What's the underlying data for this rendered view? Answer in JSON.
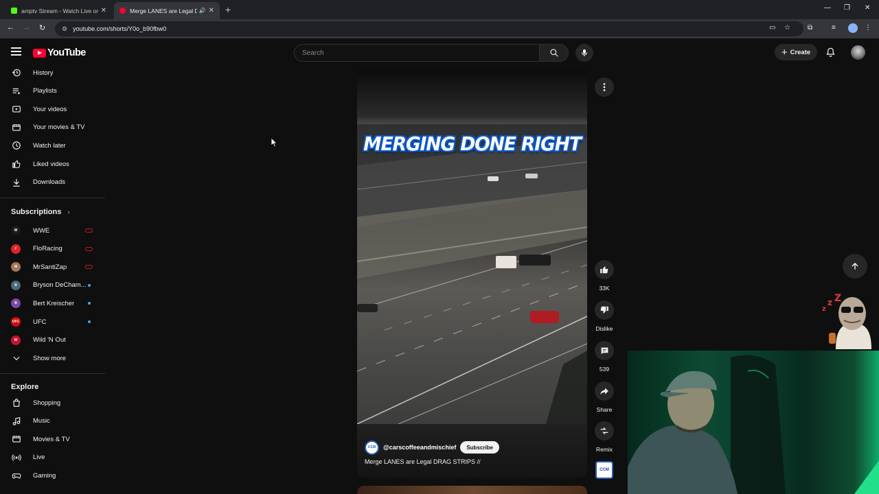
{
  "browser": {
    "tabs": [
      {
        "title": "amptv Stream - Watch Live on K",
        "favicon_color": "#53fc18",
        "active": false
      },
      {
        "title": "Merge LANES are Legal DR",
        "favicon_color": "#ff0033",
        "active": true
      }
    ],
    "url": "youtube.com/shorts/Y0o_b90fbw0"
  },
  "masthead": {
    "logo_text": "YouTube",
    "search_placeholder": "Search",
    "create_label": "Create"
  },
  "sidebar": {
    "you_items": [
      {
        "label": "History",
        "icon": "history-icon"
      },
      {
        "label": "Playlists",
        "icon": "playlists-icon"
      },
      {
        "label": "Your videos",
        "icon": "your-videos-icon"
      },
      {
        "label": "Your movies & TV",
        "icon": "movies-icon"
      },
      {
        "label": "Watch later",
        "icon": "watch-later-icon"
      },
      {
        "label": "Liked videos",
        "icon": "like-icon"
      },
      {
        "label": "Downloads",
        "icon": "download-icon"
      }
    ],
    "subscriptions_title": "Subscriptions",
    "subscriptions": [
      {
        "label": "WWE",
        "avatar_color": "#1a1a1a",
        "avatar_text": "W",
        "indicator": "live"
      },
      {
        "label": "FloRacing",
        "avatar_color": "#e4202a",
        "avatar_text": "F",
        "indicator": "live"
      },
      {
        "label": "MrSantiZap",
        "avatar_color": "#a0785a",
        "avatar_text": "M",
        "indicator": "live"
      },
      {
        "label": "Bryson DeCham...",
        "avatar_color": "#4a6a7a",
        "avatar_text": "B",
        "indicator": "new"
      },
      {
        "label": "Bert Kreischer",
        "avatar_color": "#7a4aa8",
        "avatar_text": "B",
        "indicator": "new"
      },
      {
        "label": "UFC",
        "avatar_color": "#d20a0a",
        "avatar_text": "UFC",
        "indicator": "new"
      },
      {
        "label": "Wild 'N Out",
        "avatar_color": "#c8102e",
        "avatar_text": "W",
        "indicator": "none"
      }
    ],
    "show_more": "Show more",
    "explore_title": "Explore",
    "explore_items": [
      {
        "label": "Shopping",
        "icon": "shopping-icon"
      },
      {
        "label": "Music",
        "icon": "music-icon"
      },
      {
        "label": "Movies & TV",
        "icon": "movies-icon"
      },
      {
        "label": "Live",
        "icon": "live-icon"
      },
      {
        "label": "Gaming",
        "icon": "gaming-icon"
      }
    ]
  },
  "short": {
    "overlay_title": "MERGING DONE RIGHT",
    "channel_handle": "@carscoffeeandmischief",
    "channel_avatar_text": "CCM",
    "subscribe_label": "Subscribe",
    "caption": "Merge LANES are Legal DRAG STRIPS //",
    "actions": {
      "likes": "33K",
      "dislike": "Dislike",
      "comments": "539",
      "share": "Share",
      "remix": "Remix"
    },
    "sound_thumb_text": "CCM"
  }
}
